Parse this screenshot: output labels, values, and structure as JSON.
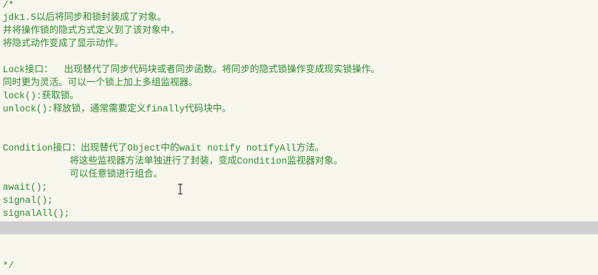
{
  "editor": {
    "comment_color": "#2e8b2e",
    "current_line_color": "#cfcfcf",
    "lines": [
      "/*",
      "jdk1.5以后将同步和锁封装成了对象。",
      "并将操作锁的隐式方式定义到了该对象中，",
      "将隐式动作变成了显示动作。",
      "",
      "Lock接口：  出现替代了同步代码块或者同步函数。将同步的隐式锁操作变成现实锁操作。",
      "同时更为灵活。可以一个锁上加上多组监视器。",
      "lock():获取锁。",
      "unlock():释放锁，通常需要定义finally代码块中。",
      "",
      "",
      "Condition接口：出现替代了Object中的wait notify notifyAll方法。",
      "            将这些监视器方法单独进行了封装，变成Condition监视器对象。",
      "            可以任意锁进行组合。",
      "await();",
      "signal();",
      "signalAll();",
      "",
      "",
      "",
      "*/"
    ]
  },
  "cursor": {
    "icon": "text-cursor-icon"
  }
}
